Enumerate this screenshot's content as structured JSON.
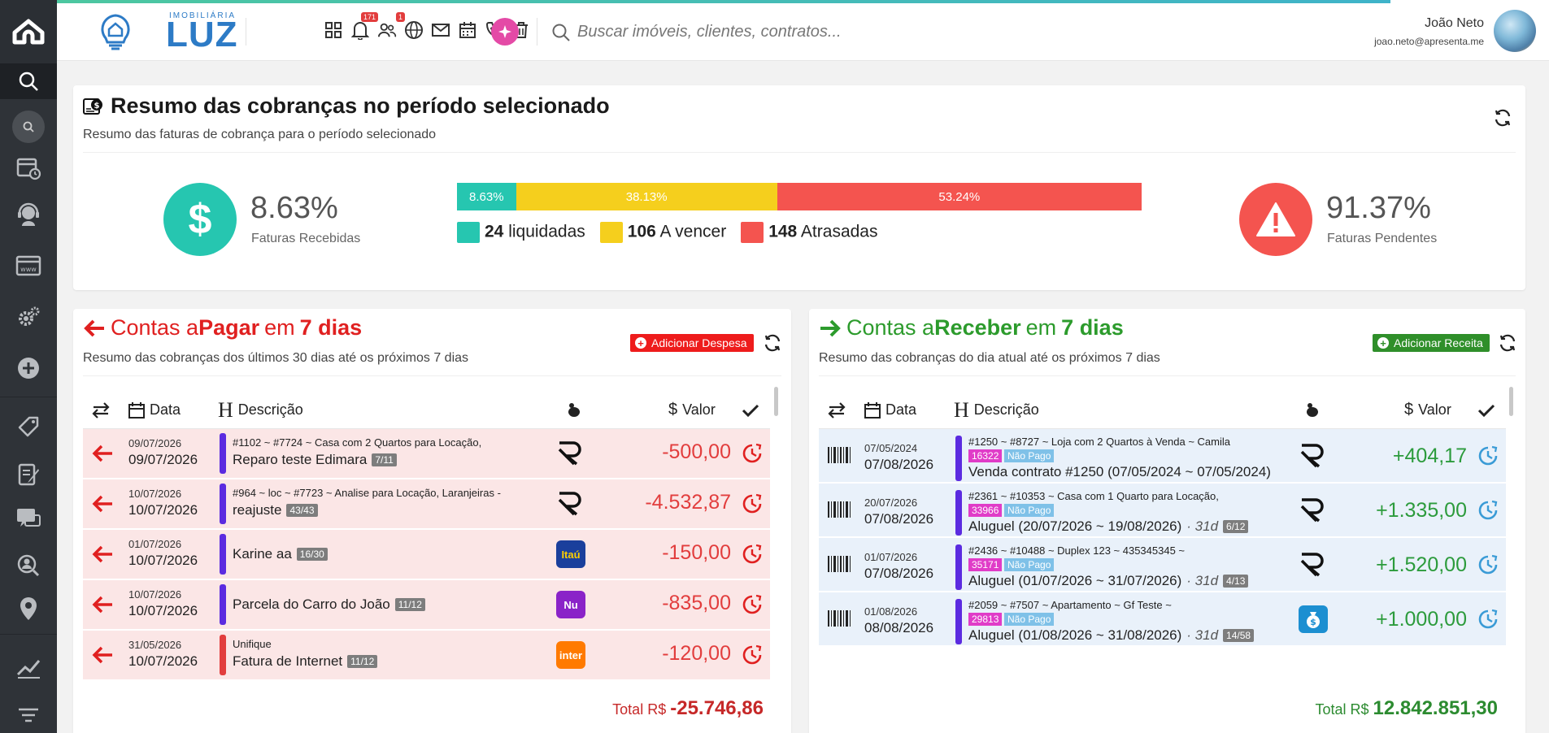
{
  "header": {
    "brand_sub": "IMOBILIÁRIA",
    "brand_name": "LUZ",
    "badge_notifications": "171",
    "badge_users": "1",
    "search_placeholder": "Buscar imóveis, clientes, contratos...",
    "user_name": "João Neto",
    "user_email": "joao.neto@apresenta.me"
  },
  "summary": {
    "title": "Resumo das cobranças no período selecionado",
    "subtitle": "Resumo das faturas de cobrança para o período selecionado",
    "received_pct": "8.63%",
    "received_label": "Faturas Recebidas",
    "pending_pct": "91.37%",
    "pending_label": "Faturas Pendentes",
    "bar": [
      {
        "label": "8.63%",
        "value": 8.63,
        "color": "#26c6b0"
      },
      {
        "label": "38.13%",
        "value": 38.13,
        "color": "#f5cf1d"
      },
      {
        "label": "53.24%",
        "value": 53.24,
        "color": "#f4544f"
      }
    ],
    "legend": [
      {
        "count": "24",
        "label": "liquidadas",
        "color": "#26c6b0"
      },
      {
        "count": "106",
        "label": "A vencer",
        "color": "#f5cf1d"
      },
      {
        "count": "148",
        "label": "Atrasadas",
        "color": "#f4544f"
      }
    ]
  },
  "pay": {
    "title_a": "Contas a ",
    "title_b": "Pagar",
    "title_c": " em ",
    "title_d": "7 dias",
    "subtitle": "Resumo das cobranças dos últimos 30 dias até os próximos 7 dias",
    "add_label": "Adicionar Despesa",
    "col_date": "Data",
    "col_desc": "Descrição",
    "col_value": "Valor",
    "total_label": "Total R$",
    "total_value": "-25.746,86",
    "rows": [
      {
        "date1": "09/07/2026",
        "date2": "09/07/2026",
        "line1": "#1102 ~ #7724 ~ Casa com 2 Quartos para Locação,",
        "line2": "Reparo teste Edimara",
        "pill": "7/11",
        "bank": "R",
        "value": "-500,00",
        "flag": "#5b2be0"
      },
      {
        "date1": "10/07/2026",
        "date2": "10/07/2026",
        "line1": "#964 ~ loc ~ #7723 ~ Analise para Locação, Laranjeiras -",
        "line2": "reajuste",
        "pill": "43/43",
        "bank": "R",
        "value": "-4.532,87",
        "flag": "#5b2be0"
      },
      {
        "date1": "01/07/2026",
        "date2": "10/07/2026",
        "line1": "",
        "line2": "Karine aa",
        "pill": "16/30",
        "bank": "Itaú",
        "value": "-150,00",
        "flag": "#5b2be0"
      },
      {
        "date1": "10/07/2026",
        "date2": "10/07/2026",
        "line1": "",
        "line2": "Parcela do Carro do João",
        "pill": "11/12",
        "bank": "Nu",
        "value": "-835,00",
        "flag": "#5b2be0"
      },
      {
        "date1": "31/05/2026",
        "date2": "10/07/2026",
        "line1": "Unifique",
        "line2": "Fatura de Internet",
        "pill": "11/12",
        "bank": "inter",
        "value": "-120,00",
        "flag": "#e23d3d"
      }
    ]
  },
  "rec": {
    "title_a": "Contas a ",
    "title_b": "Receber",
    "title_c": " em ",
    "title_d": "7 dias",
    "subtitle": "Resumo das cobranças do dia atual até os próximos 7 dias",
    "add_label": "Adicionar Receita",
    "col_date": "Data",
    "col_desc": "Descrição",
    "col_value": "Valor",
    "total_label": "Total R$",
    "total_value": "12.842.851,30",
    "rows": [
      {
        "date1": "07/05/2024",
        "date2": "07/08/2026",
        "line1": "#1250 ~ #8727 ~ Loja com 2 Quartos à Venda ~ Camila",
        "tag": "16322",
        "status": "Não Pago",
        "line2": "Venda contrato #1250 (07/05/2024 ~ 07/05/2024)",
        "dur": "",
        "pill": "",
        "bank": "R",
        "value": "+404,17"
      },
      {
        "date1": "20/07/2026",
        "date2": "07/08/2026",
        "line1": "#2361 ~ #10353 ~ Casa com 1 Quarto para Locação,",
        "tag": "33966",
        "status": "Não Pago",
        "line2": "Aluguel (20/07/2026 ~ 19/08/2026)",
        "dur": "· 31d",
        "pill": "6/12",
        "bank": "R",
        "value": "+1.335,00"
      },
      {
        "date1": "01/07/2026",
        "date2": "07/08/2026",
        "line1": "#2436 ~ #10488 ~ Duplex 123 ~ 435345345 ~",
        "tag": "35171",
        "status": "Não Pago",
        "line2": "Aluguel (01/07/2026 ~ 31/07/2026)",
        "dur": "· 31d",
        "pill": "4/13",
        "bank": "R",
        "value": "+1.520,00"
      },
      {
        "date1": "01/08/2026",
        "date2": "08/08/2026",
        "line1": "#2059 ~ #7507 ~ Apartamento ~ Gf Teste ~",
        "tag": "29813",
        "status": "Não Pago",
        "line2": "Aluguel (01/08/2026 ~ 31/08/2026)",
        "dur": "· 31d",
        "pill": "14/58",
        "bank": "$",
        "value": "+1.000,00"
      }
    ]
  }
}
